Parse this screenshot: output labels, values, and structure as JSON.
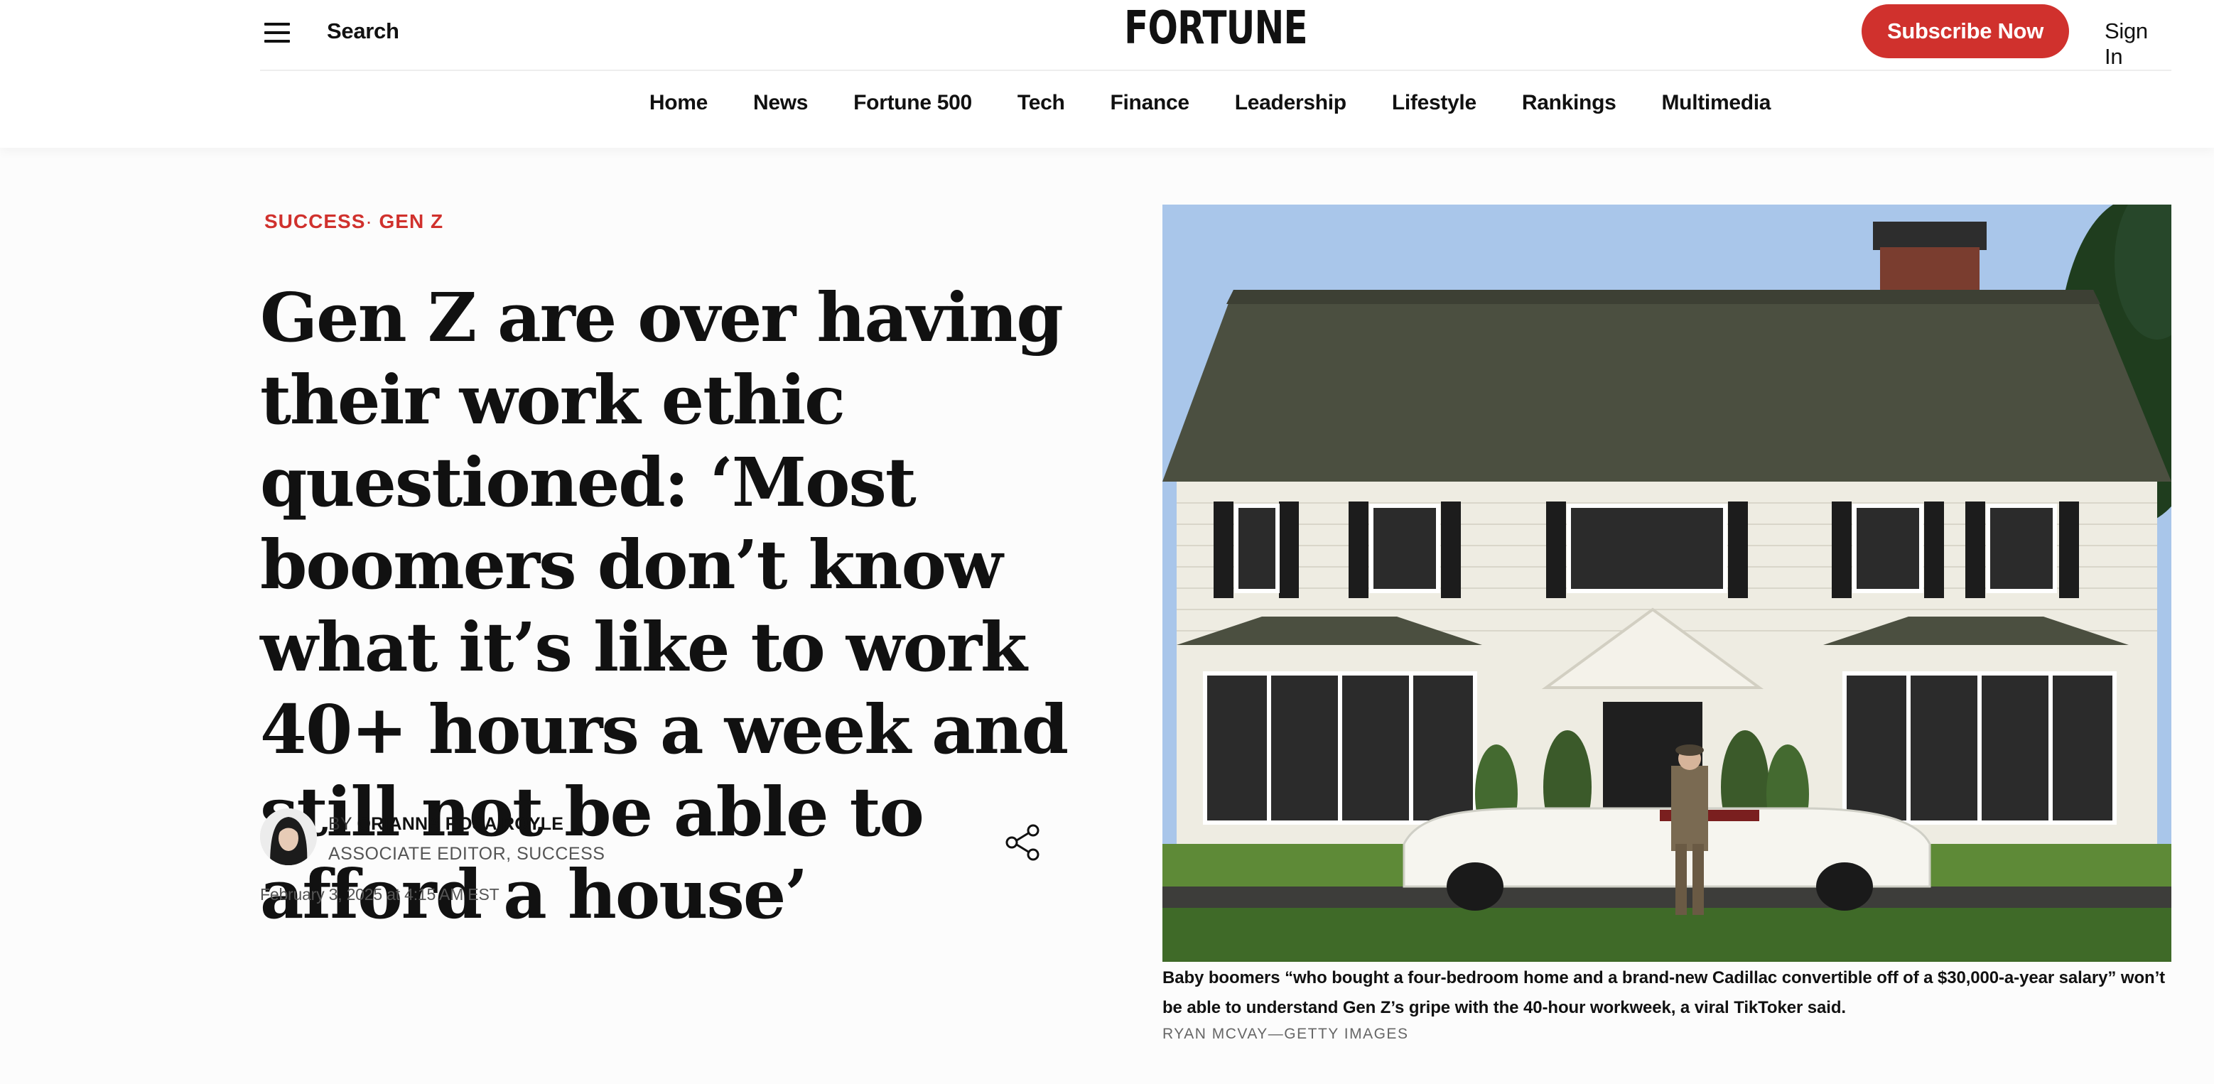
{
  "header": {
    "search_label": "Search",
    "logo": "FORTUNE",
    "subscribe_label": "Subscribe Now",
    "signin_label": "Sign In",
    "brand_color": "#d0312d"
  },
  "nav": {
    "items": [
      {
        "label": "Home"
      },
      {
        "label": "News"
      },
      {
        "label": "Fortune 500"
      },
      {
        "label": "Tech"
      },
      {
        "label": "Finance"
      },
      {
        "label": "Leadership"
      },
      {
        "label": "Lifestyle"
      },
      {
        "label": "Rankings"
      },
      {
        "label": "Multimedia"
      }
    ]
  },
  "article": {
    "category_primary": "SUCCESS",
    "category_separator": "·",
    "category_secondary": "GEN Z",
    "headline": "Gen Z are over having their work ethic questioned: ‘Most boomers don’t know what it’s like to work 40+ hours a week and still not be able to afford a house’",
    "byline_prefix": "BY",
    "author_name": "ORIANNA ROSA ROYLE",
    "author_role": "ASSOCIATE EDITOR, SUCCESS",
    "date": "February 3, 2025 at 4:15 AM EST"
  },
  "image": {
    "caption": "Baby boomers “who bought a four-bedroom home and a brand-new Cadillac convertible off of a $30,000-a-year salary” won’t be able to understand Gen Z’s gripe with the 40-hour workweek, a viral TikToker said.",
    "credit": "RYAN MCVAY—GETTY IMAGES"
  },
  "icons": {
    "menu": "hamburger-menu-icon",
    "share": "share-icon"
  }
}
